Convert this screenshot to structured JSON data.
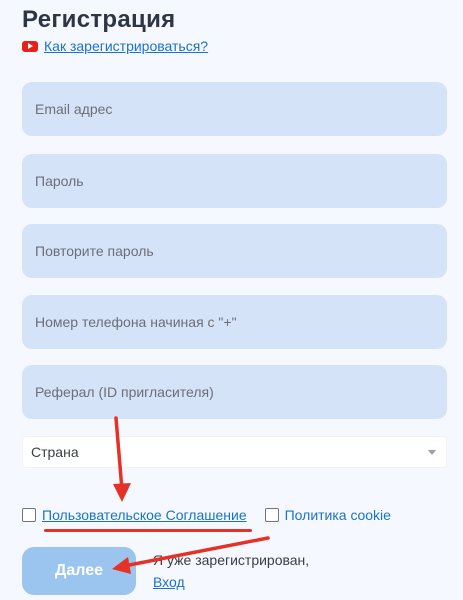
{
  "header": {
    "title": "Регистрация",
    "howto_link": "Как зарегистрироваться?",
    "howto_icon": "youtube-icon"
  },
  "form": {
    "email_placeholder": "Email адрес",
    "password_placeholder": "Пароль",
    "repeat_password_placeholder": "Повторите пароль",
    "phone_placeholder": "Номер телефона начиная с \"+\"",
    "referral_placeholder": "Реферал (ID пригласителя)",
    "country_select": "Страна"
  },
  "agreements": {
    "user_agreement": "Пользовательское Соглашение",
    "cookie_policy": "Политика cookie"
  },
  "actions": {
    "next_label": "Далее",
    "already_registered": "Я уже зарегистрирован,",
    "login_link": "Вход"
  },
  "colors": {
    "field_bg": "#d5e3f8",
    "link": "#1a73c9",
    "button_bg": "#9bc4ee",
    "annotation_red": "#e53126"
  }
}
